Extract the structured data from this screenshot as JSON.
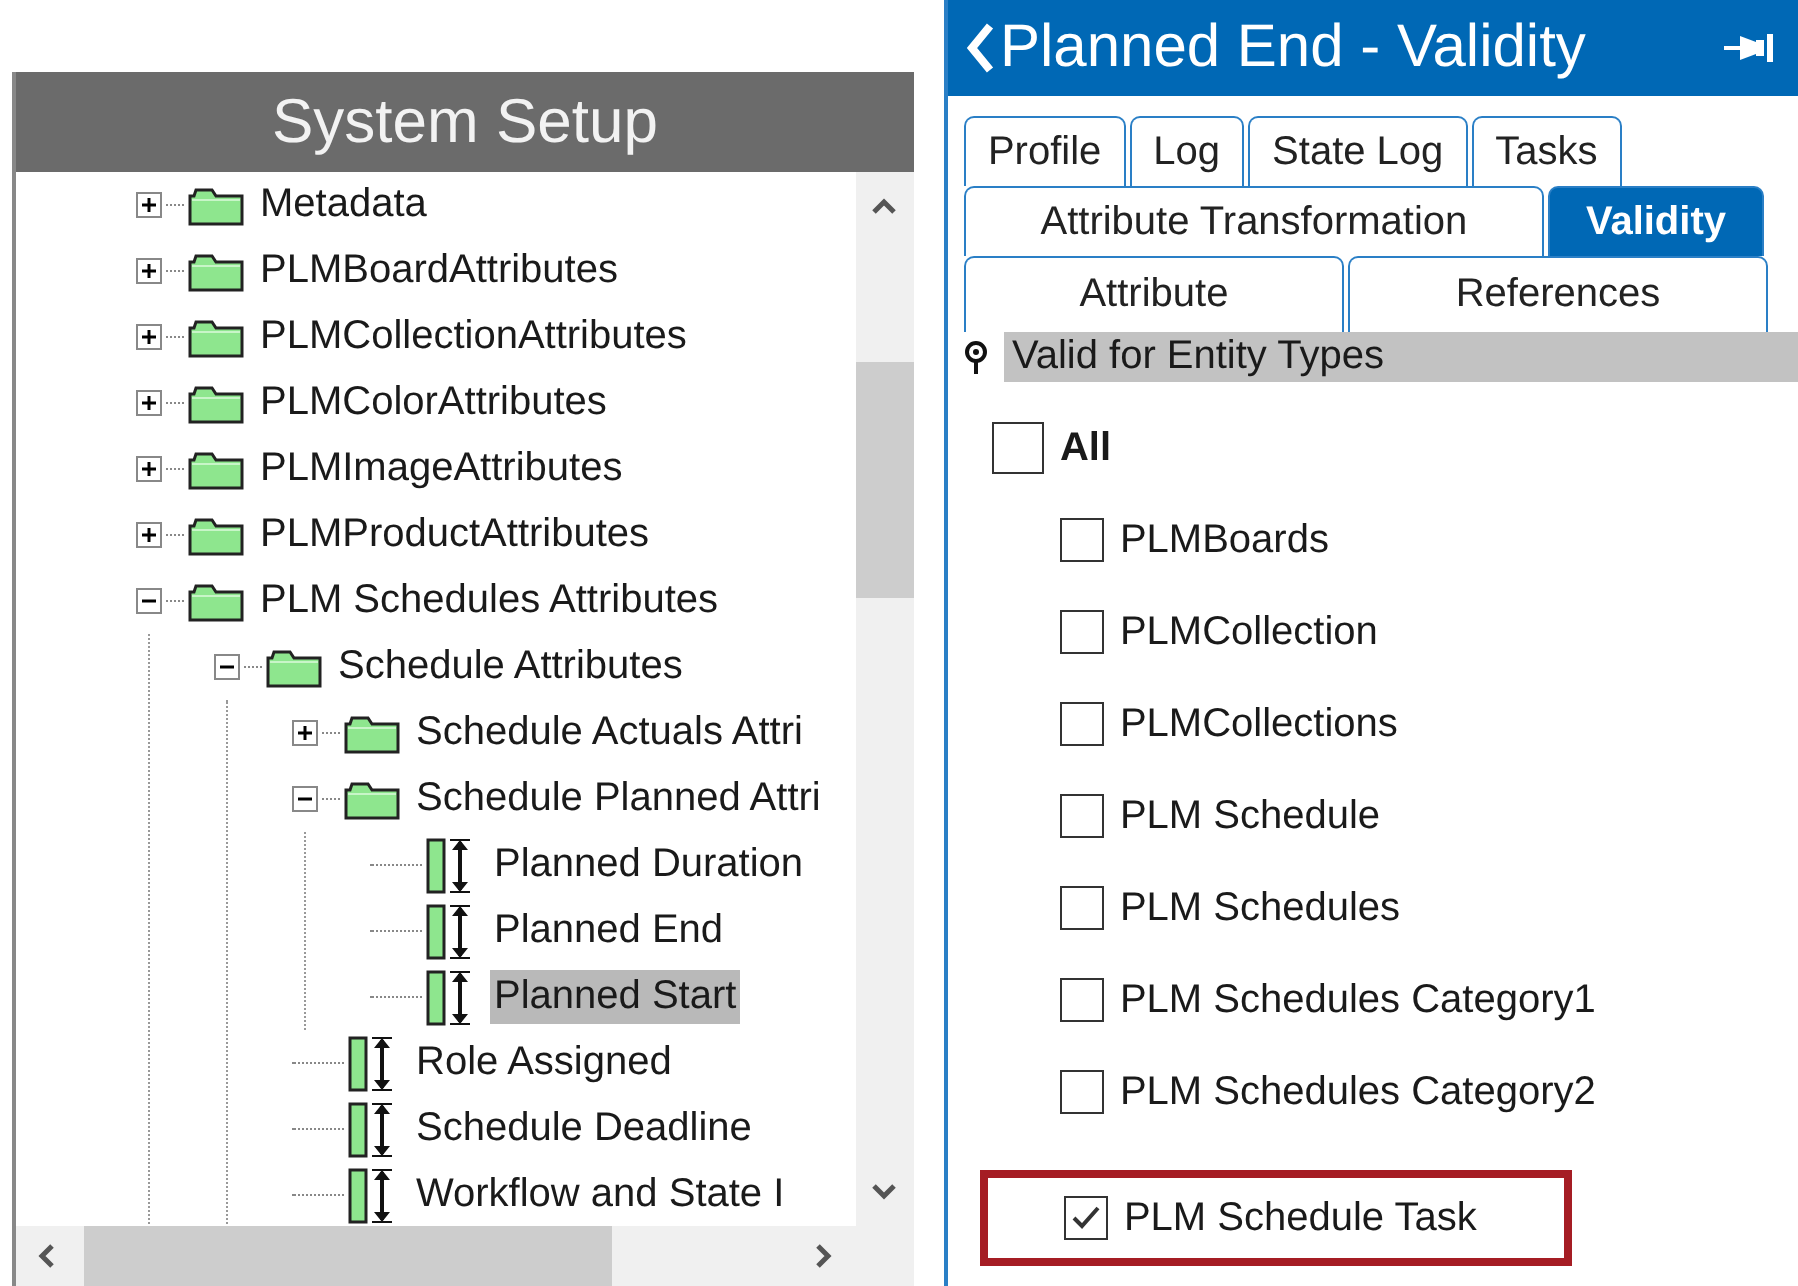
{
  "left_panel": {
    "title": "System Setup",
    "tree": [
      {
        "label": "Metadata",
        "kind": "folder",
        "expanded": false,
        "selected": false
      },
      {
        "label": "PLMBoardAttributes",
        "kind": "folder",
        "expanded": false,
        "selected": false
      },
      {
        "label": "PLMCollectionAttributes",
        "kind": "folder",
        "expanded": false,
        "selected": false
      },
      {
        "label": "PLMColorAttributes",
        "kind": "folder",
        "expanded": false,
        "selected": false
      },
      {
        "label": "PLMImageAttributes",
        "kind": "folder",
        "expanded": false,
        "selected": false
      },
      {
        "label": "PLMProductAttributes",
        "kind": "folder",
        "expanded": false,
        "selected": false
      },
      {
        "label": "PLM Schedules Attributes",
        "kind": "folder",
        "expanded": true,
        "selected": false,
        "children": [
          {
            "label": "Schedule Attributes",
            "kind": "folder",
            "expanded": true,
            "selected": false,
            "children": [
              {
                "label": "Schedule Actuals Attri",
                "kind": "folder",
                "expanded": false,
                "selected": false
              },
              {
                "label": "Schedule Planned Attri",
                "kind": "folder",
                "expanded": true,
                "selected": false,
                "children": [
                  {
                    "label": "Planned Duration",
                    "kind": "attribute",
                    "selected": false
                  },
                  {
                    "label": "Planned End",
                    "kind": "attribute",
                    "selected": false
                  },
                  {
                    "label": "Planned Start",
                    "kind": "attribute",
                    "selected": true
                  }
                ]
              },
              {
                "label": "Role Assigned",
                "kind": "attribute",
                "selected": false
              },
              {
                "label": "Schedule Deadline",
                "kind": "attribute",
                "selected": false
              },
              {
                "label": "Workflow and State I",
                "kind": "attribute",
                "selected": false
              }
            ]
          }
        ]
      }
    ]
  },
  "right_panel": {
    "title": "Planned End - Validity",
    "tab_rows": [
      [
        {
          "label": "Profile",
          "selected": false
        },
        {
          "label": "Log",
          "selected": false
        },
        {
          "label": "State Log",
          "selected": false
        },
        {
          "label": "Tasks",
          "selected": false
        }
      ],
      [
        {
          "label": "Attribute Transformation",
          "selected": false
        },
        {
          "label": "Validity",
          "selected": true
        }
      ],
      [
        {
          "label": "Attribute",
          "selected": false
        },
        {
          "label": "References",
          "selected": false
        }
      ]
    ],
    "section_title": "Valid for Entity Types",
    "all": {
      "label": "All",
      "checked": false
    },
    "entity_types": [
      {
        "label": "PLMBoards",
        "checked": false,
        "highlighted": false
      },
      {
        "label": "PLMCollection",
        "checked": false,
        "highlighted": false
      },
      {
        "label": "PLMCollections",
        "checked": false,
        "highlighted": false
      },
      {
        "label": "PLM Schedule",
        "checked": false,
        "highlighted": false
      },
      {
        "label": "PLM Schedules",
        "checked": false,
        "highlighted": false
      },
      {
        "label": "PLM Schedules Category1",
        "checked": false,
        "highlighted": false
      },
      {
        "label": "PLM Schedules Category2",
        "checked": false,
        "highlighted": false
      },
      {
        "label": "PLM Schedule Task",
        "checked": true,
        "highlighted": true
      }
    ]
  }
}
